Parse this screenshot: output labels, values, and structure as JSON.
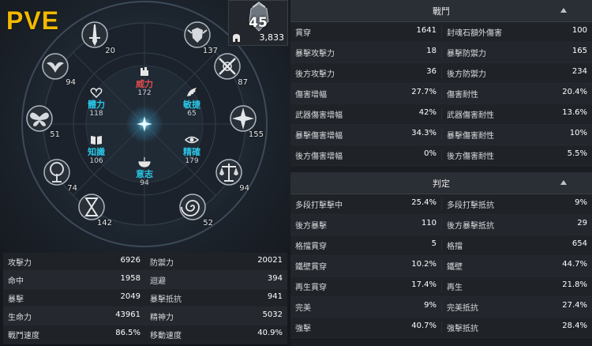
{
  "badge": "PVE",
  "character": {
    "level": "45",
    "gear_score": "3,833"
  },
  "wheel": {
    "outer": [
      {
        "icon": "sword-emblem-icon",
        "value": "20"
      },
      {
        "icon": "winged-shield-icon",
        "value": "137"
      },
      {
        "icon": "bird-icon",
        "value": "94"
      },
      {
        "icon": "crossed-arrows-icon",
        "value": "87"
      },
      {
        "icon": "butterfly-icon",
        "value": "51"
      },
      {
        "icon": "star-burst-icon",
        "value": "155"
      },
      {
        "icon": "tree-icon",
        "value": "74"
      },
      {
        "icon": "scales-icon",
        "value": "94"
      },
      {
        "icon": "hourglass-icon",
        "value": "142"
      },
      {
        "icon": "spiral-icon",
        "value": "52"
      }
    ],
    "inner": [
      {
        "name": "威力",
        "value": "172",
        "icon": "fist-icon",
        "color": "#e24c4c"
      },
      {
        "name": "體力",
        "value": "118",
        "icon": "heart-icon",
        "color": "#29c7e6"
      },
      {
        "name": "敏捷",
        "value": "65",
        "icon": "wing-icon",
        "color": "#29c7e6"
      },
      {
        "name": "知識",
        "value": "106",
        "icon": "book-icon",
        "color": "#29c7e6"
      },
      {
        "name": "精確",
        "value": "179",
        "icon": "eye-icon",
        "color": "#29c7e6"
      },
      {
        "name": "意志",
        "value": "94",
        "icon": "bowl-icon",
        "color": "#29c7e6"
      }
    ]
  },
  "basic_stats": [
    [
      {
        "k": "攻擊力",
        "v": "6926"
      },
      {
        "k": "防禦力",
        "v": "20021"
      }
    ],
    [
      {
        "k": "命中",
        "v": "1958"
      },
      {
        "k": "迴避",
        "v": "394"
      }
    ],
    [
      {
        "k": "暴擊",
        "v": "2049"
      },
      {
        "k": "暴擊抵抗",
        "v": "941"
      }
    ],
    [
      {
        "k": "生命力",
        "v": "43961"
      },
      {
        "k": "精神力",
        "v": "5032"
      }
    ],
    [
      {
        "k": "戰鬥速度",
        "v": "86.5%"
      },
      {
        "k": "移動速度",
        "v": "40.9%"
      }
    ]
  ],
  "sections": [
    {
      "title": "戰鬥",
      "rows": [
        [
          {
            "k": "貫穿",
            "v": "1641"
          },
          {
            "k": "封魂石額外傷害",
            "v": "100"
          }
        ],
        [
          {
            "k": "暴擊攻擊力",
            "v": "18"
          },
          {
            "k": "暴擊防禦力",
            "v": "165"
          }
        ],
        [
          {
            "k": "後方攻擊力",
            "v": "36"
          },
          {
            "k": "後方防禦力",
            "v": "234"
          }
        ],
        [
          {
            "k": "傷害增幅",
            "v": "27.7%"
          },
          {
            "k": "傷害耐性",
            "v": "20.4%"
          }
        ],
        [
          {
            "k": "武器傷害增幅",
            "v": "42%"
          },
          {
            "k": "武器傷害耐性",
            "v": "13.6%"
          }
        ],
        [
          {
            "k": "暴擊傷害增幅",
            "v": "34.3%"
          },
          {
            "k": "暴擊傷害耐性",
            "v": "10%"
          }
        ],
        [
          {
            "k": "後方傷害增幅",
            "v": "0%"
          },
          {
            "k": "後方傷害耐性",
            "v": "5.5%"
          }
        ]
      ]
    },
    {
      "title": "判定",
      "rows": [
        [
          {
            "k": "多段打擊擊中",
            "v": "25.4%"
          },
          {
            "k": "多段打擊抵抗",
            "v": "9%"
          }
        ],
        [
          {
            "k": "後方暴擊",
            "v": "110"
          },
          {
            "k": "後方暴擊抵抗",
            "v": "29"
          }
        ],
        [
          {
            "k": "格擋貫穿",
            "v": "5"
          },
          {
            "k": "格擋",
            "v": "654"
          }
        ],
        [
          {
            "k": "鐵壁貫穿",
            "v": "10.2%"
          },
          {
            "k": "鐵壁",
            "v": "44.7%"
          }
        ],
        [
          {
            "k": "再生貫穿",
            "v": "17.4%"
          },
          {
            "k": "再生",
            "v": "21.8%"
          }
        ],
        [
          {
            "k": "完美",
            "v": "9%"
          },
          {
            "k": "完美抵抗",
            "v": "27.4%"
          }
        ],
        [
          {
            "k": "強擊",
            "v": "40.7%"
          },
          {
            "k": "強擊抵抗",
            "v": "28.4%"
          }
        ]
      ]
    }
  ]
}
